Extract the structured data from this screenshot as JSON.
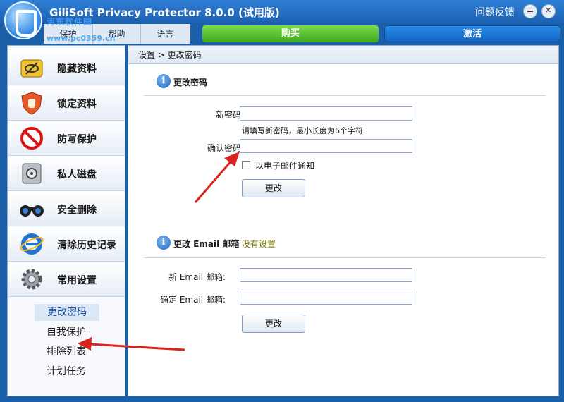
{
  "window": {
    "title": "GiliSoft Privacy Protector 8.0.0 (试用版)",
    "feedback": "问题反馈"
  },
  "watermark": {
    "line1": "河东软件园",
    "line2": "www.pc0359.cn"
  },
  "menu": {
    "protect": "保护",
    "help": "帮助",
    "language": "语言",
    "buy": "购买",
    "activate": "激活"
  },
  "sidebar": {
    "items": [
      {
        "label": "隐藏资料",
        "icon": "hide-data-icon"
      },
      {
        "label": "锁定资料",
        "icon": "lock-hand-icon"
      },
      {
        "label": "防写保护",
        "icon": "no-write-icon"
      },
      {
        "label": "私人磁盘",
        "icon": "safe-disk-icon"
      },
      {
        "label": "安全删除",
        "icon": "shredder-binoculars-icon"
      },
      {
        "label": "清除历史记录",
        "icon": "ie-history-icon"
      },
      {
        "label": "常用设置",
        "icon": "gear-icon"
      }
    ],
    "subitems": [
      "更改密码",
      "自我保护",
      "排除列表",
      "计划任务"
    ],
    "active_subitem": "更改密码"
  },
  "main": {
    "breadcrumb": "设置 > 更改密码",
    "password_section": {
      "title": "更改密码",
      "new_label": "新密码:",
      "new_value": "",
      "hint": "请填写新密码，最小长度为6个字符.",
      "confirm_label": "确认密码:",
      "confirm_value": "",
      "notify_label": "以电子邮件通知",
      "notify_checked": false,
      "change_button": "更改"
    },
    "email_section": {
      "title": "更改 Email 邮箱",
      "status": "没有设置",
      "new_label": "新 Email 邮箱:",
      "new_value": "",
      "confirm_label": "确定 Email 邮箱:",
      "confirm_value": "",
      "change_button": "更改"
    }
  },
  "colors": {
    "accent": "#1b5fa8",
    "buy": "#3fa71f",
    "activate": "#1266c4",
    "arrow": "#d9231d"
  }
}
